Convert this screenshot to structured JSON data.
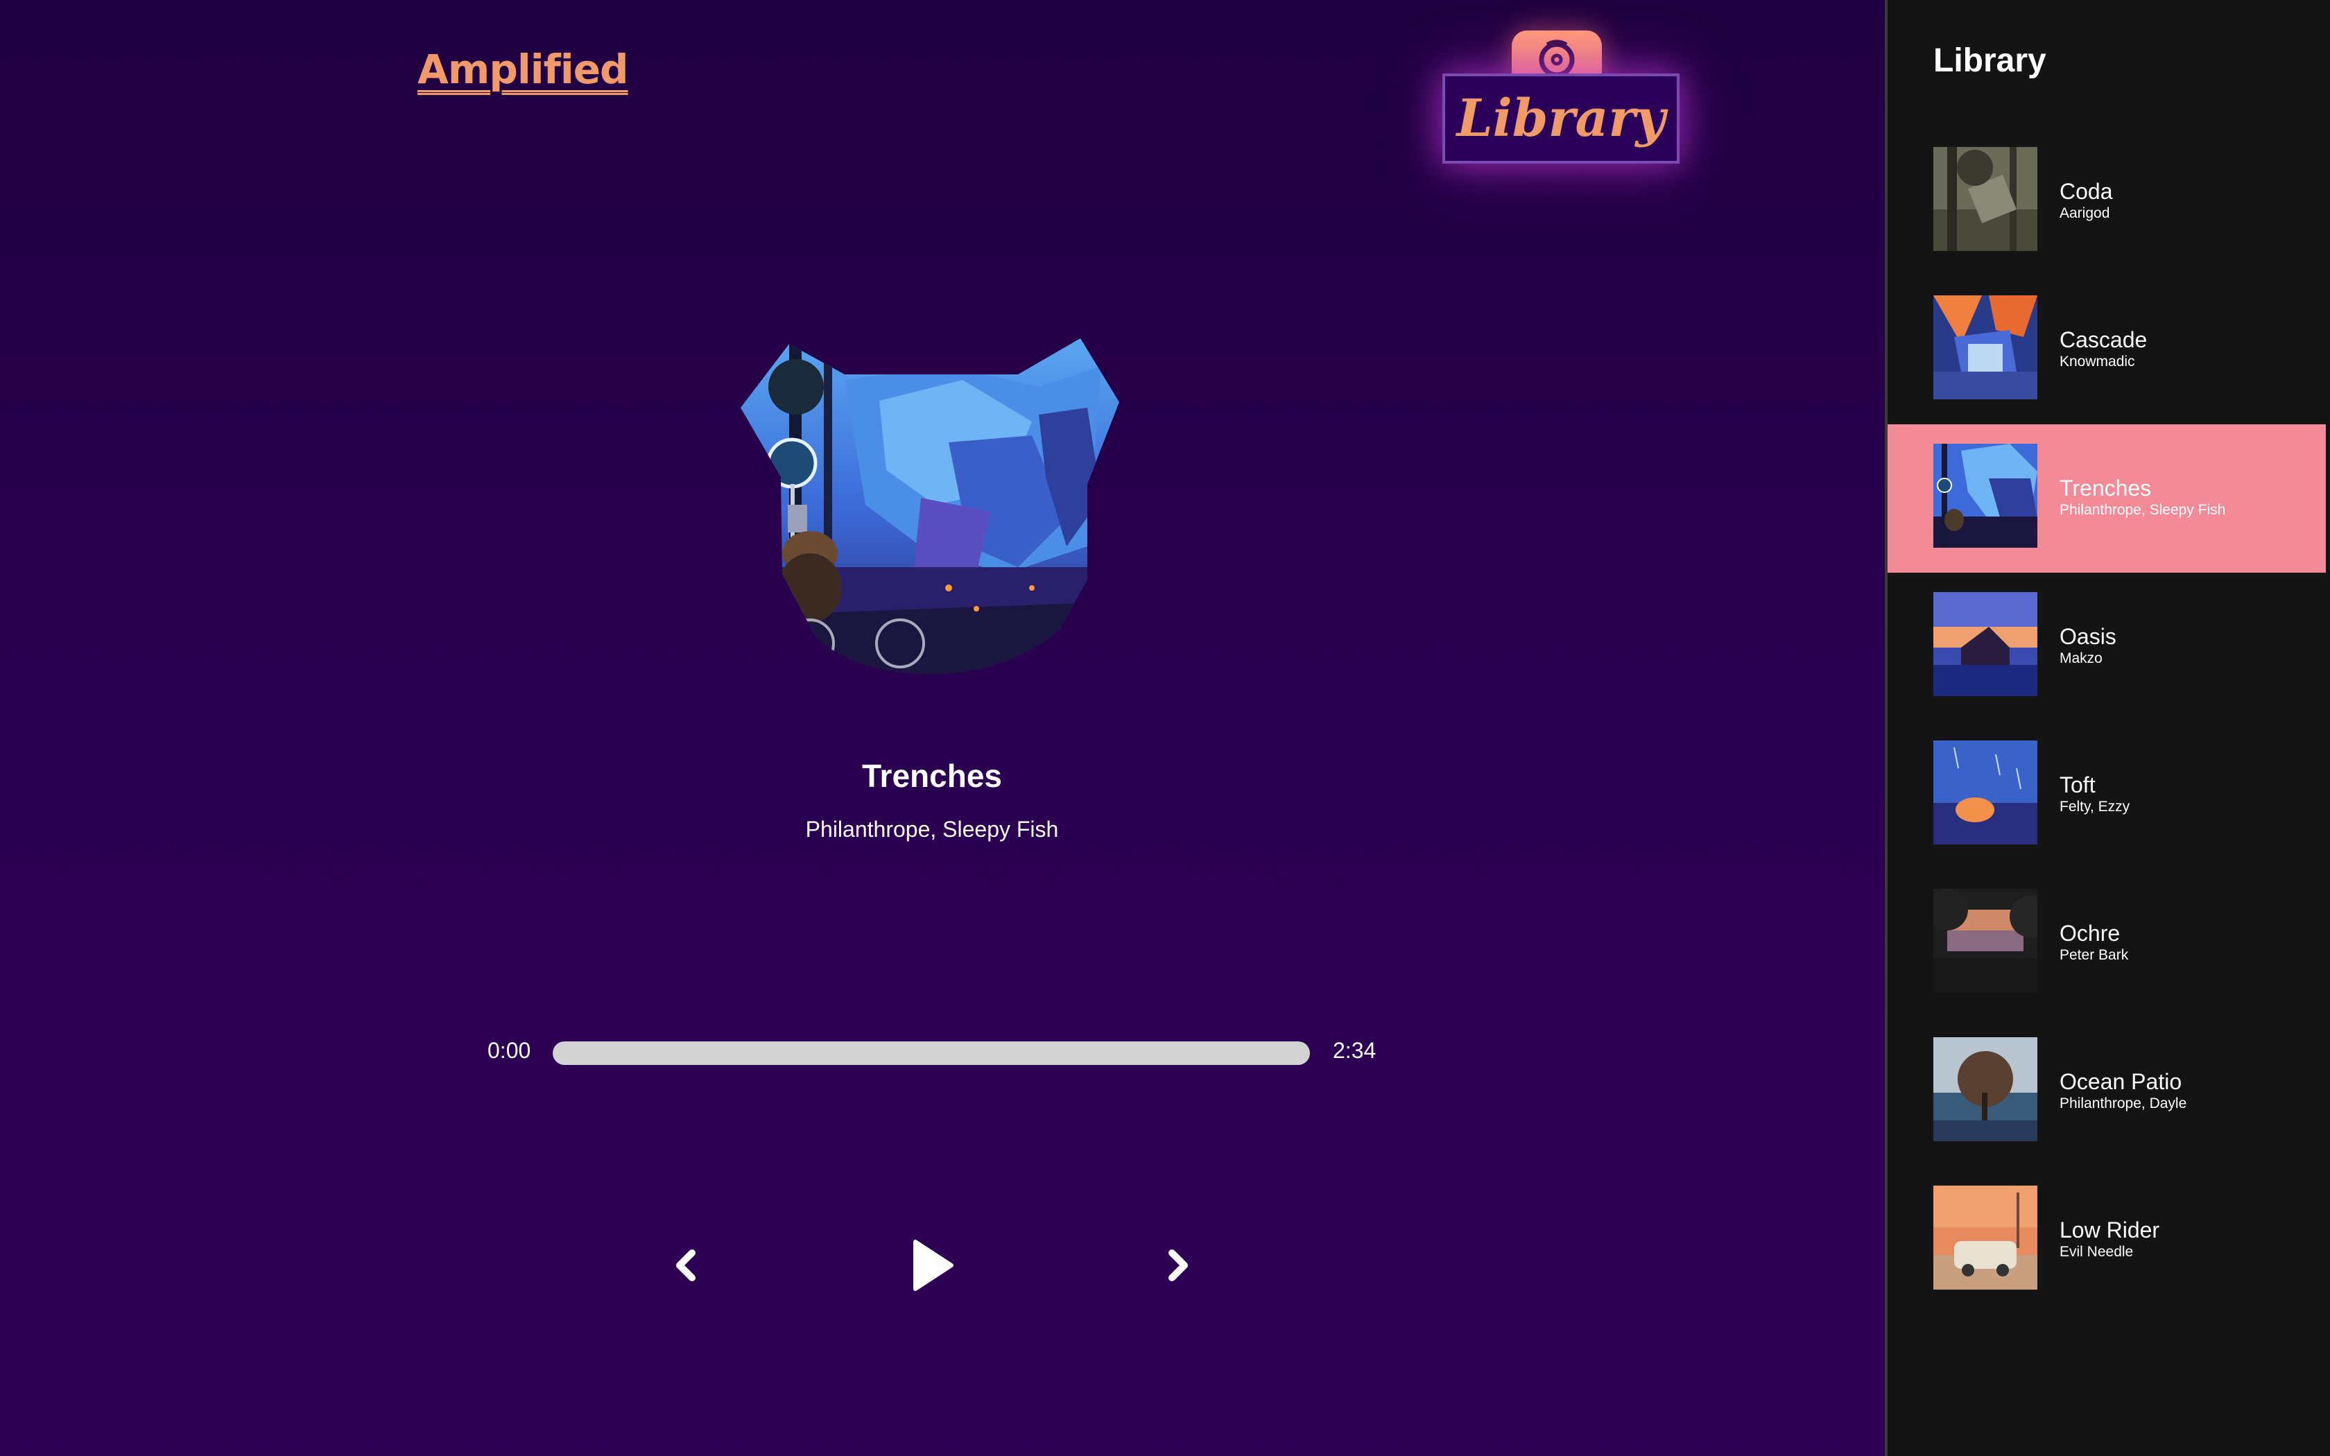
{
  "app": {
    "logo": "Amplified",
    "library_button": "Library"
  },
  "player": {
    "title": "Trenches",
    "artist": "Philanthrope, Sleepy Fish",
    "time_current": "0:00",
    "time_total": "2:34",
    "progress": 0
  },
  "library": {
    "title": "Library",
    "items": [
      {
        "title": "Coda",
        "artist": "Aarigod",
        "active": false,
        "art": "coda"
      },
      {
        "title": "Cascade",
        "artist": "Knowmadic",
        "active": false,
        "art": "cascade"
      },
      {
        "title": "Trenches",
        "artist": "Philanthrope, Sleepy Fish",
        "active": true,
        "art": "trenches"
      },
      {
        "title": "Oasis",
        "artist": "Makzo",
        "active": false,
        "art": "oasis"
      },
      {
        "title": "Toft",
        "artist": "Felty, Ezzy",
        "active": false,
        "art": "toft"
      },
      {
        "title": "Ochre",
        "artist": "Peter Bark",
        "active": false,
        "art": "ochre"
      },
      {
        "title": "Ocean Patio",
        "artist": "Philanthrope, Dayle",
        "active": false,
        "art": "ocean-patio"
      },
      {
        "title": "Low Rider",
        "artist": "Evil Needle",
        "active": false,
        "art": "low-rider"
      }
    ]
  },
  "icons": {
    "library_tab": "disc-icon",
    "prev": "chevron-left-icon",
    "play": "play-icon",
    "next": "chevron-right-icon"
  },
  "colors": {
    "accent": "#f0996a",
    "active_item": "#f28b97",
    "background_top": "#1f0040",
    "background_bottom": "#2e0055",
    "sidebar": "#141414"
  }
}
